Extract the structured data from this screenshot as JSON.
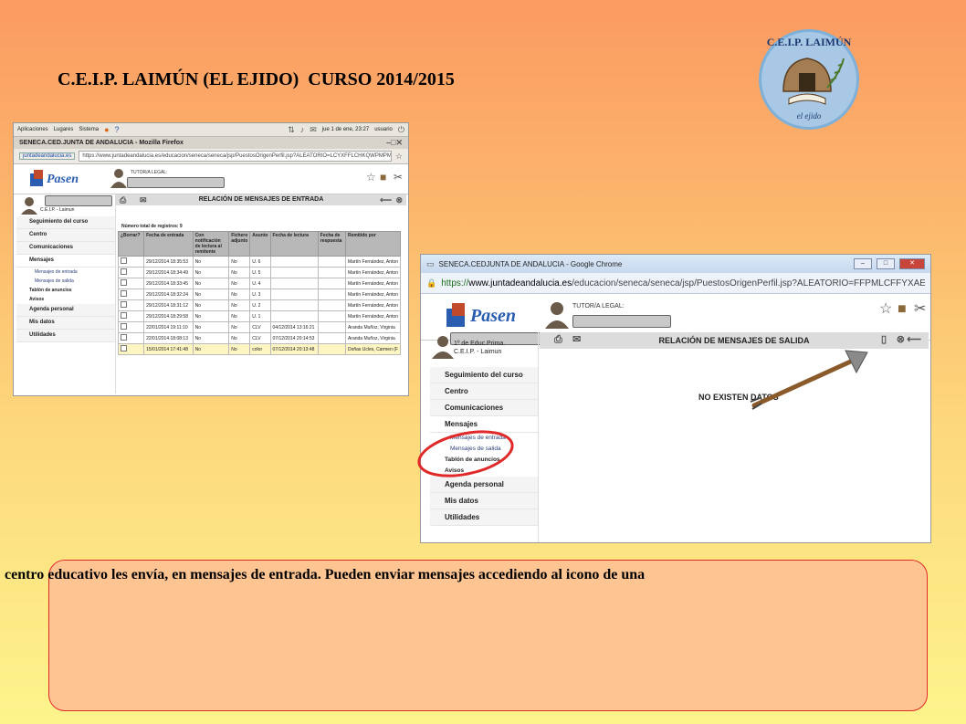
{
  "title": "C.E.I.P. LAIMÚN (EL EJIDO)  CURSO 2014/2015",
  "logo": {
    "text": "C.E.I.P. LAIMÚN",
    "signature": "el ejido"
  },
  "firefox": {
    "panel_menu": [
      "Aplicaciones",
      "Lugares",
      "Sistema"
    ],
    "panel_clock": "jue 1 de ene, 23:27",
    "panel_user": "usuario",
    "window_title": "SENECA.CED.JUNTA DE ANDALUCIA - Mozilla Firefox",
    "url_host": "juntadeandalucia.es",
    "url_full": "https://www.juntadeandalucia.es/educacion/seneca/seneca/jsp/PuestosOrigenPerfil.jsp?ALEATORIO=LCYXFFLCHKQWPMPMLC",
    "tutor_label": "TUTOR/A LEGAL:",
    "school": "C.E.I.P. - Laimun",
    "section_title": "RELACIÓN DE MENSAJES DE ENTRADA",
    "record_count": "Número total de registros: 9",
    "sidebar": [
      "Seguimiento del curso",
      "Centro",
      "Comunicaciones",
      "Mensajes",
      "Mensajes de entrada",
      "Mensajes de salida",
      "Tablón de anuncios",
      "Avisos",
      "Agenda personal",
      "Mis datos",
      "Utilidades"
    ],
    "columns": [
      "¿Borrar?",
      "Fecha de entrada",
      "Con notificación de lectura al remitente",
      "Fichero adjunto",
      "Asunto",
      "Fecha de lectura",
      "Fecha de respuesta",
      "Remitido por"
    ],
    "rows": [
      [
        "29/12/2014 18:35:53",
        "No",
        "No",
        "U. 6",
        "",
        "",
        "Martín Fernández, Anton"
      ],
      [
        "29/12/2014 18:34:49",
        "No",
        "No",
        "U. 5",
        "",
        "",
        "Martín Fernández, Anton"
      ],
      [
        "29/12/2014 18:33:45",
        "No",
        "No",
        "U. 4",
        "",
        "",
        "Martín Fernández, Anton"
      ],
      [
        "29/12/2014 18:32:24",
        "No",
        "No",
        "U. 3",
        "",
        "",
        "Martín Fernández, Anton"
      ],
      [
        "29/12/2014 18:31:12",
        "No",
        "No",
        "U. 2",
        "",
        "",
        "Martín Fernández, Anton"
      ],
      [
        "29/12/2014 18:29:58",
        "No",
        "No",
        "U. 1",
        "",
        "",
        "Martín Fernández, Anton"
      ],
      [
        "22/01/2014 19:11:10",
        "No",
        "No",
        "CLV",
        "04/12/2014 13:16:21",
        "",
        "Aranda Muñoz, Virginia"
      ],
      [
        "22/01/2014 18:08:13",
        "No",
        "No",
        "CLV",
        "07/12/2014 20:14:53",
        "",
        "Aranda Muñoz, Virginia"
      ],
      [
        "15/01/2014 17:41:48",
        "No",
        "No",
        "color",
        "07/12/2014 20:13:48",
        "",
        "Doñas Ucles, Carmen (F"
      ]
    ]
  },
  "chrome": {
    "window_title": "SENECA.CEDJUNTA DE ANDALUCIA - Google Chrome",
    "url_scheme": "https://",
    "url_host": "www.juntadeandalucia.es",
    "url_path": "/educacion/seneca/seneca/jsp/PuestosOrigenPerfil.jsp?ALEATORIO=FFPMLCFFYXAEYXGSKV",
    "tutor_label": "TUTOR/A LEGAL:",
    "course": "1º de Educ.Prima.",
    "school": "C.E.I.P. - Laimun",
    "section_title": "RELACIÓN DE MENSAJES DE SALIDA",
    "empty_text": "NO EXISTEN DATOS",
    "sidebar": [
      "Seguimiento del curso",
      "Centro",
      "Comunicaciones",
      "Mensajes",
      "Mensajes de entrada",
      "Mensajes de salida",
      "Tablón de anuncios",
      "Avisos",
      "Agenda personal",
      "Mis datos",
      "Utilidades"
    ]
  },
  "caption": "centro educativo les envía, en mensajes de entrada. Pueden enviar mensajes accediendo al icono de una",
  "colors": {
    "annotation_circle": "#e02a2a",
    "arrow": "#8a5a2a"
  }
}
